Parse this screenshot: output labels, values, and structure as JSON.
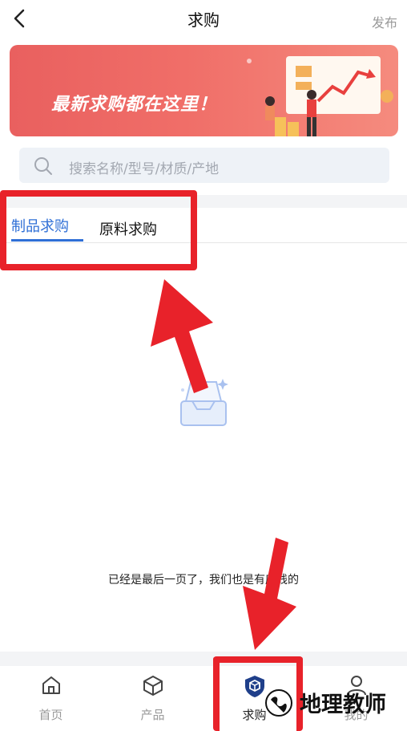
{
  "header": {
    "title": "求购",
    "publish_label": "发布"
  },
  "banner": {
    "text": "最新求购都在这里！"
  },
  "search": {
    "placeholder": "搜索名称/型号/材质/产地"
  },
  "tabs": [
    {
      "label": "制品求购",
      "active": true
    },
    {
      "label": "原料求购",
      "active": false
    }
  ],
  "empty_state": {
    "end_text": "已经是最后一页了，我们也是有底线的"
  },
  "nav": {
    "items": [
      {
        "label": "首页",
        "icon": "home-icon",
        "active": false
      },
      {
        "label": "产品",
        "icon": "cube-icon",
        "active": false
      },
      {
        "label": "求购",
        "icon": "buy-shield-icon",
        "active": true
      },
      {
        "label": "我的",
        "icon": "user-icon",
        "active": false
      }
    ]
  },
  "watermark": {
    "text": "地理教师"
  },
  "colors": {
    "accent": "#2f6fd6",
    "annotation": "#e8222a",
    "banner": "#ee6a66"
  }
}
